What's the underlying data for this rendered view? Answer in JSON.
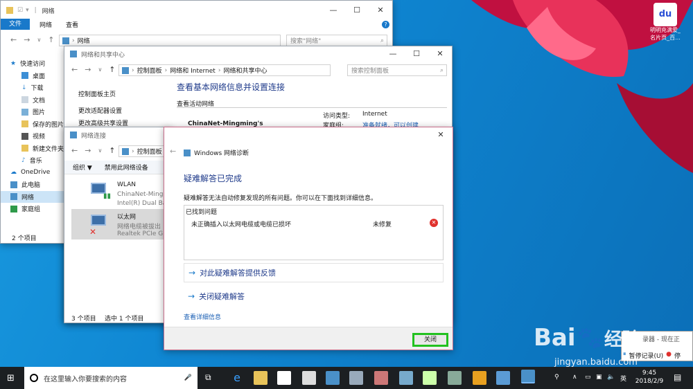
{
  "desktop_icon": {
    "label": "明明充满爱_名片页_百..."
  },
  "explorer": {
    "title": "网络",
    "ribbon_tabs": [
      "文件",
      "网络",
      "查看"
    ],
    "address": "网络",
    "search_placeholder": "搜索\"网络\"",
    "sidebar": [
      "快速访问",
      "桌面",
      "下载",
      "文档",
      "图片",
      "保存的图片",
      "视频",
      "新建文件夹",
      "音乐",
      "OneDrive",
      "此电脑",
      "网络",
      "家庭组"
    ],
    "status": "2 个项目"
  },
  "network_center": {
    "title": "网络和共享中心",
    "breadcrumb": [
      "控制面板",
      "网络和 Internet",
      "网络和共享中心"
    ],
    "search_placeholder": "搜索控制面板",
    "left_links": [
      "控制面板主页",
      "更改适配器设置",
      "更改高级共享设置"
    ],
    "heading": "查看基本网络信息并设置连接",
    "active_label": "查看活动网络",
    "network_name": "ChinaNet-Mingming's",
    "access_type_label": "访问类型:",
    "access_type_value": "Internet",
    "homegroup_label": "家庭组:",
    "homegroup_value": "准备就绪，可以创建"
  },
  "connections": {
    "title": "网络连接",
    "breadcrumb": "控制面板",
    "toolbar": [
      "组织 ▼",
      "禁用此网络设备"
    ],
    "items": [
      {
        "name": "WLAN",
        "line1": "ChinaNet-Mingm",
        "line2": "Intel(R) Dual Bar"
      },
      {
        "name": "以太网",
        "line1": "网络电缆被拔出",
        "line2": "Realtek PCIe GB"
      }
    ],
    "status_count": "3 个项目",
    "status_selected": "选中 1 个项目"
  },
  "dialog": {
    "title": "Windows 网络诊断",
    "heading": "疑难解答已完成",
    "description": "疑难解答无法自动修复发现的所有问题。你可以在下面找到详细信息。",
    "problems_header": "已找到问题",
    "problem_text": "未正确插入以太网电缆或电缆已损坏",
    "problem_status": "未修复",
    "feedback_link": "对此疑难解答提供反馈",
    "close_troubleshoot_link": "关闭疑难解答",
    "details_link": "查看详细信息",
    "close_button": "关闭"
  },
  "recorder": {
    "line1": "录器 - 现在正",
    "btn1": "暂停记录(U)",
    "btn2": "停"
  },
  "watermark": {
    "brand": "Bai",
    "brand2": "经验",
    "url": "jingyan.baidu.com"
  },
  "taskbar": {
    "search_placeholder": "在这里输入你要搜索的内容",
    "ime": "英",
    "time": "9:45",
    "date": "2018/2/9"
  },
  "colors": {
    "accent": "#1979ca",
    "highlight": "#22c11f",
    "error": "#e0312d"
  }
}
